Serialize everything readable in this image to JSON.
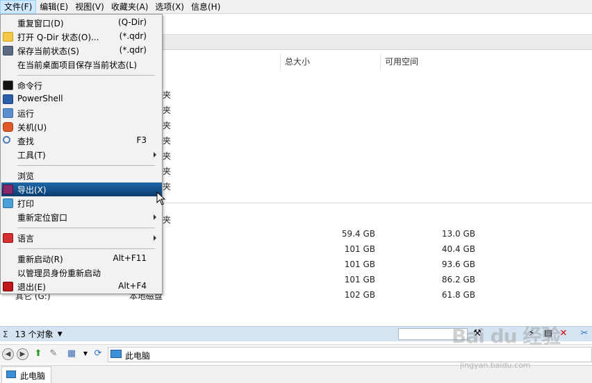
{
  "menubar": {
    "items": [
      "文件(F)",
      "编辑(E)",
      "视图(V)",
      "收藏夹(A)",
      "选项(X)",
      "信息(H)"
    ]
  },
  "list_header": {
    "total_size": "总大小",
    "free_space": "可用空间"
  },
  "folder_rows": [
    "夹",
    "夹",
    "夹",
    "夹",
    "夹",
    "夹",
    "夹"
  ],
  "drive_group_first": "夹",
  "drives": [
    {
      "total": "59.4 GB",
      "free": "13.0 GB"
    },
    {
      "total": "101 GB",
      "free": "40.4 GB"
    },
    {
      "total": "101 GB",
      "free": "93.6 GB"
    },
    {
      "total": "101 GB",
      "free": "86.2 GB"
    },
    {
      "name": "其它 (G:)",
      "type": "本地磁盘",
      "total": "102 GB",
      "free": "61.8 GB"
    }
  ],
  "status": {
    "sigma": "Σ",
    "count": "13 个对象"
  },
  "nav": {
    "path": "此电脑"
  },
  "bottom_tab": {
    "label": "此电脑"
  },
  "file_menu": {
    "items": [
      {
        "label": "重复窗口(D)",
        "shortcut": "(Q-Dir)"
      },
      {
        "label": "打开 Q-Dir 状态(O)...",
        "shortcut": "(*.qdr)"
      },
      {
        "label": "保存当前状态(S)",
        "shortcut": "(*.qdr)"
      },
      {
        "label": "在当前桌面项目保存当前状态(L)",
        "shortcut": ""
      },
      {
        "label": "命令行",
        "shortcut": ""
      },
      {
        "label": "PowerShell",
        "shortcut": ""
      },
      {
        "label": "运行",
        "shortcut": ""
      },
      {
        "label": "关机(U)",
        "shortcut": ""
      },
      {
        "label": "查找",
        "shortcut": "F3"
      },
      {
        "label": "工具(T)",
        "shortcut": ""
      },
      {
        "label": "浏览",
        "shortcut": ""
      },
      {
        "label": "导出(X)",
        "shortcut": ""
      },
      {
        "label": "打印",
        "shortcut": ""
      },
      {
        "label": "重新定位窗口",
        "shortcut": ""
      },
      {
        "label": "语言",
        "shortcut": ""
      },
      {
        "label": "重新启动(R)",
        "shortcut": "Alt+F11"
      },
      {
        "label": "以管理员身份重新启动",
        "shortcut": ""
      },
      {
        "label": "退出(E)",
        "shortcut": "Alt+F4"
      }
    ]
  },
  "watermark": {
    "text": "Bai du 经验",
    "url": "jingyan.baidu.com"
  },
  "colors": {
    "highlight": "#0e4f87",
    "status_bar": "#d6e4f2",
    "menu_bg": "#f2f2f2"
  }
}
